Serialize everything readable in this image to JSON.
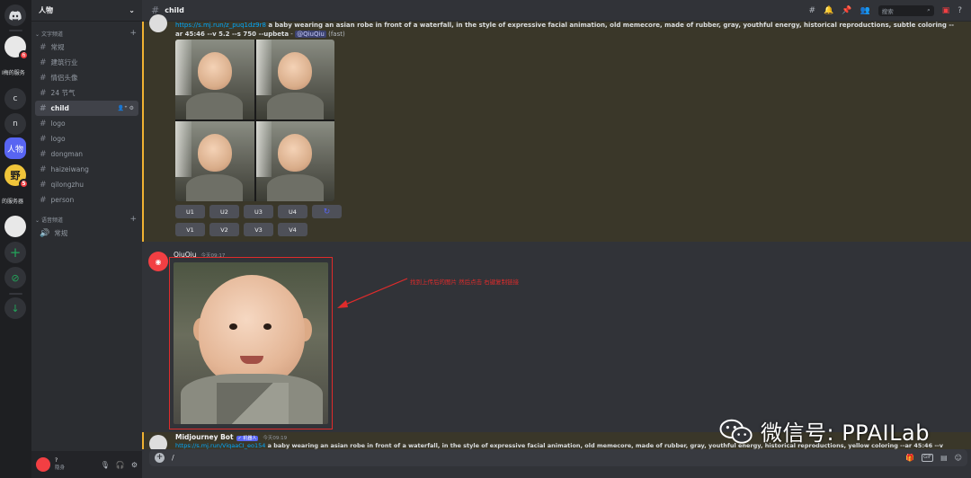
{
  "rail": {
    "servers": [
      {
        "glyph": "",
        "badge": "6"
      },
      {
        "label": "I梅的服务"
      },
      {
        "glyph": "c"
      },
      {
        "glyph": "n"
      },
      {
        "glyph": "人物"
      },
      {
        "glyph": "野",
        "badge": "5"
      },
      {
        "label": "的服务器"
      },
      {
        "glyph": ""
      },
      {
        "glyph": "+"
      },
      {
        "glyph": "⊘"
      },
      {
        "glyph": "↓"
      }
    ]
  },
  "server": {
    "name": "人物",
    "categories": [
      {
        "name": "文字频道",
        "channels": [
          "常规",
          "建筑行业",
          "情侣头像",
          "24 节气",
          "child",
          "logo",
          "logo",
          "dongman",
          "haizeiwang",
          "qilongzhu",
          "person"
        ]
      },
      {
        "name": "语音频道",
        "channels": [
          "常规"
        ]
      }
    ],
    "selected_channel": "child"
  },
  "user": {
    "name": "?",
    "status": "隐身"
  },
  "channel": {
    "name": "child"
  },
  "search": {
    "placeholder": "搜索"
  },
  "messages": {
    "first": {
      "prompt_link": "https://s.mj.run/z_puq1dz9r8",
      "prompt_text": " a baby wearing an asian robe in front of a waterfall, in the style of expressive facial animation, old memecore, made of rubber, gray, youthful energy, historical reproductions, subtle coloring --ar 45:46 --v 5.2 --s 750 --upbeta",
      "dash": " - ",
      "mention": "@QiuQiu",
      "suffix": " (fast)",
      "upscale_buttons": [
        "U1",
        "U2",
        "U3",
        "U4"
      ],
      "variation_buttons": [
        "V1",
        "V2",
        "V3",
        "V4"
      ],
      "refresh_icon": "↻"
    },
    "second": {
      "author": "QiuQiu",
      "time": "今天09:17",
      "annotation": "找到上传后的图片  然后点击  右键复制链接"
    },
    "third": {
      "author": "Midjourney Bot",
      "tag": "✓ 机器人",
      "time": "今天09:19",
      "preview_link": "https://s.mj.run/ViqaaCI_eo154",
      "preview_text": " a baby wearing an asian robe in front of a waterfall, in the style of expressive facial animation, old memecore, made of rubber, gray, youthful energy, historical reproductions, yellow coloring --ar 45:46 --v"
    }
  },
  "composer": {
    "value": "/"
  },
  "watermark": {
    "text": "微信号: PPAILab"
  }
}
